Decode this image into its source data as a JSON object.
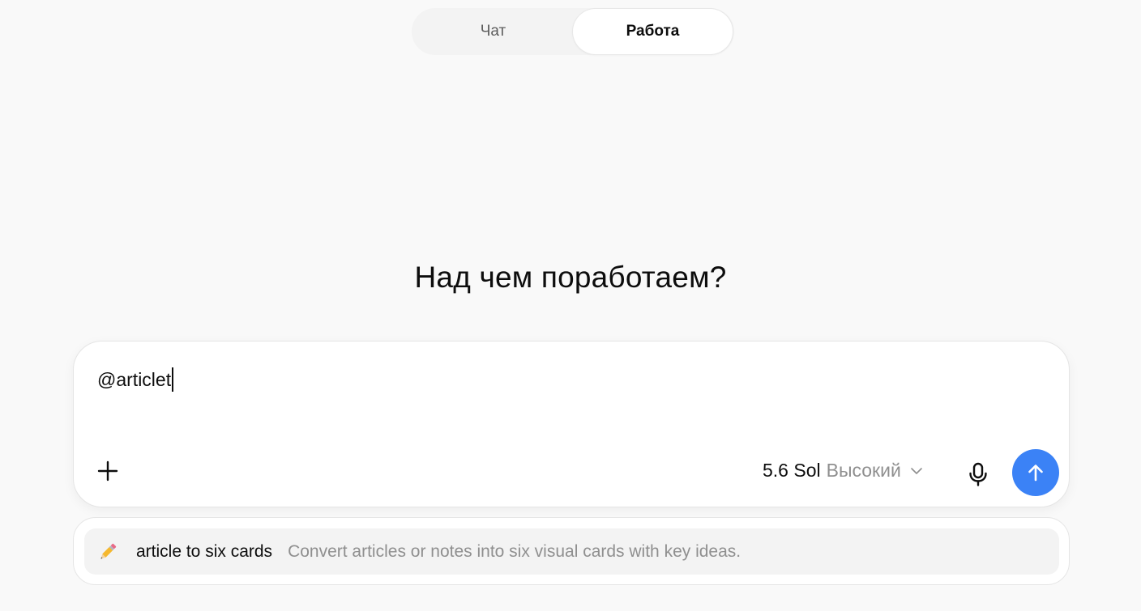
{
  "mode_toggle": {
    "tabs": [
      {
        "label": "Чат",
        "active": false
      },
      {
        "label": "Работа",
        "active": true
      }
    ]
  },
  "heading": "Над чем поработаем?",
  "composer": {
    "input_value": "@articlet",
    "add_icon": "plus-icon",
    "model": {
      "name": "5.6 Sol",
      "effort": "Высокий",
      "icon": "chevron-down-icon"
    },
    "mic_icon": "microphone-icon",
    "send_icon": "arrow-up-icon",
    "send_color": "#3b82f6"
  },
  "suggestions": [
    {
      "icon": "pencil-icon",
      "title": "article to six cards",
      "description": "Convert articles or notes into six visual cards with key ideas."
    }
  ]
}
